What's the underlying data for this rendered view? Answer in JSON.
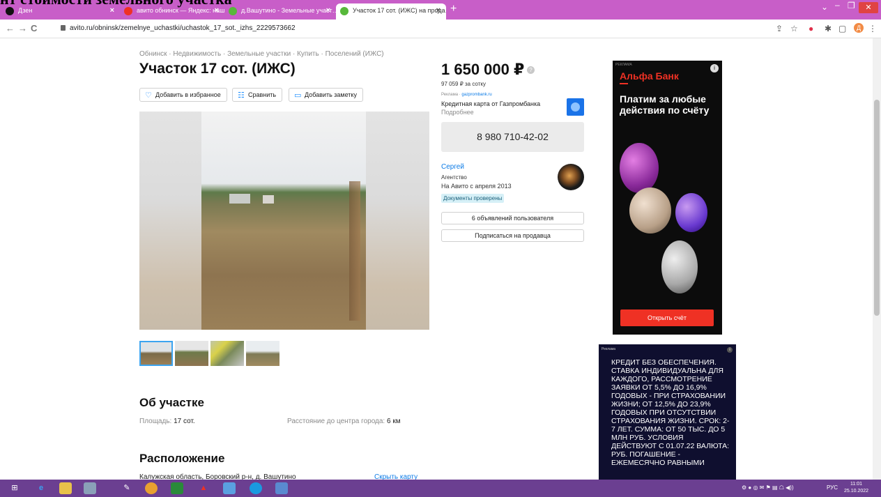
{
  "browser": {
    "tabs": [
      {
        "label": "Дзен",
        "active": false,
        "icon_color": "#111111"
      },
      {
        "label": "авито обнинск — Яндекс: нашл…",
        "active": false,
        "icon_color": "#ef3124"
      },
      {
        "label": "д.Вашутино - Земельные участ…",
        "active": false,
        "icon_color": "#57b83a"
      },
      {
        "label": "Участок 17 сот. (ИЖС) на прода…",
        "active": true,
        "icon_color": "#57b83a"
      }
    ],
    "new_tab": "+",
    "url": "avito.ru/obninsk/zemelnye_uchastki/uchastok_17_sot._izhs_2229573662",
    "profile_initial": "Д"
  },
  "overlay_heading": "нт стоимости земельного участка",
  "listing": {
    "breadcrumbs": "Обнинск · Недвижимость · Земельные участки · Купить · Поселений (ИЖС)",
    "title": "Участок 17 сот. (ИЖС)",
    "actions": {
      "favorite": "Добавить в избранное",
      "compare": "Сравнить",
      "note": "Добавить заметку"
    },
    "about": {
      "heading": "Об участке",
      "area_label": "Площадь:",
      "area_value": "17 сот.",
      "distance_label": "Расстояние до центра города:",
      "distance_value": "6 км"
    },
    "location": {
      "heading": "Расположение",
      "address": "Калужская область, Боровский р-н, д. Вашутино",
      "hide_map": "Скрыть карту"
    }
  },
  "price": {
    "value": "1 650 000 ₽",
    "per_sotka": "97 059 ₽ за сотку"
  },
  "inline_ad": {
    "label": "Реклама ·",
    "domain": "gazprombank.ru",
    "text": "Кредитная карта от Газпромбанка",
    "more": "Подробнее"
  },
  "phone": "8 980 710-42-02",
  "seller": {
    "name": "Сергей",
    "type": "Агентство",
    "since": "На Авито с апреля 2013",
    "verified": "Документы проверены",
    "listings_button": "6 объявлений пользователя",
    "subscribe_button": "Подписаться на продавца"
  },
  "ad_alfa": {
    "tag": "РЕКЛАМА",
    "info": "i",
    "brand": "Альфа Банк",
    "slogan": "Платим за любые действия по счёту",
    "cta": "Открыть счёт"
  },
  "ad_credit": {
    "tag": "Реклама",
    "info": "i",
    "text": "КРЕДИТ БЕЗ ОБЕСПЕЧЕНИЯ. СТАВКА ИНДИВИДУАЛЬНА ДЛЯ КАЖДОГО, РАССМОТРЕНИЕ ЗАЯВКИ ОТ 5,5% ДО 16,9% ГОДОВЫХ - ПРИ СТРАХОВАНИИ ЖИЗНИ; ОТ 12,5% ДО 23,9% ГОДОВЫХ ПРИ ОТСУТСТВИИ СТРАХОВАНИЯ ЖИЗНИ. СРОК: 2-7 ЛЕТ. СУММА: ОТ 50 ТЫС. ДО 5 МЛН РУБ. УСЛОВИЯ ДЕЙСТВУЮТ С 01.07.22 ВАЛЮТА: РУБ. ПОГАШЕНИЕ - ЕЖЕМЕСЯЧНО РАВНЫМИ"
  },
  "taskbar": {
    "lang": "РУС",
    "time": "11:01",
    "date": "25.10.2022"
  },
  "colors": {
    "tabbar": "#c85ec8",
    "taskbar": "#6b3f91",
    "link": "#0a7ae6",
    "alfa_red": "#ef3124"
  }
}
